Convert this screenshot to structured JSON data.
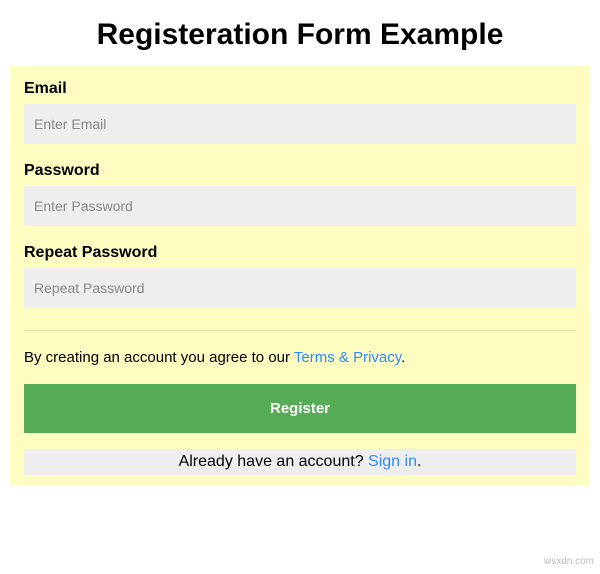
{
  "title": "Registeration Form Example",
  "form": {
    "email": {
      "label": "Email",
      "placeholder": "Enter Email",
      "value": ""
    },
    "password": {
      "label": "Password",
      "placeholder": "Enter Password",
      "value": ""
    },
    "repeat_password": {
      "label": "Repeat Password",
      "placeholder": "Repeat Password",
      "value": ""
    },
    "agree_text": "By creating an account you agree to our ",
    "agree_link": "Terms & Privacy",
    "agree_period": ".",
    "register_button": "Register",
    "signin_text": "Already have an account? ",
    "signin_link": "Sign in",
    "signin_period": "."
  },
  "watermark": "wsxdn.com"
}
